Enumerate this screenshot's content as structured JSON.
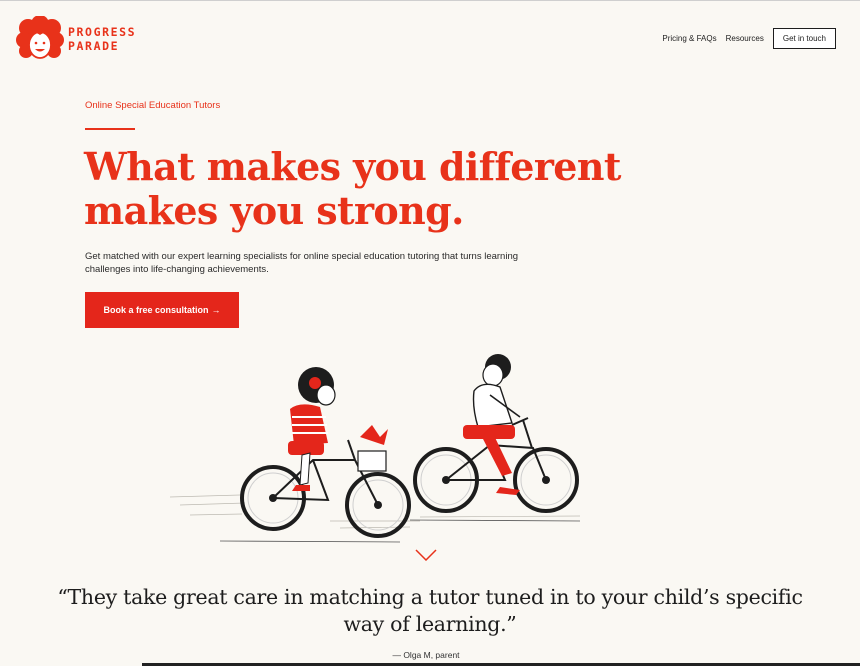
{
  "brand": {
    "line1": "PROGRESS",
    "line2": "PARADE",
    "logo_icon": "curly-hair-face-icon",
    "color": "#e8321a"
  },
  "nav": {
    "items": [
      "Pricing & FAQs",
      "Resources"
    ],
    "cta": "Get in touch"
  },
  "hero": {
    "eyebrow": "Online Special Education Tutors",
    "headline_line1": "What makes you different",
    "headline_line2": "makes you strong.",
    "lead": "Get matched with our expert learning specialists for online special education tutoring that turns learning challenges into life-changing achievements.",
    "button_label": "Book a free consultation",
    "button_arrow": "→",
    "illustration": "two-children-riding-bicycles",
    "scroll_icon": "chevron-down-icon"
  },
  "testimonial": {
    "quote": "“They take great care in matching a tutor tuned in to your child’s specific way of learning.”",
    "attribution": "— Olga M, parent"
  },
  "colors": {
    "accent": "#e8321a",
    "background": "#faf8f3",
    "text": "#1d1d1d"
  }
}
